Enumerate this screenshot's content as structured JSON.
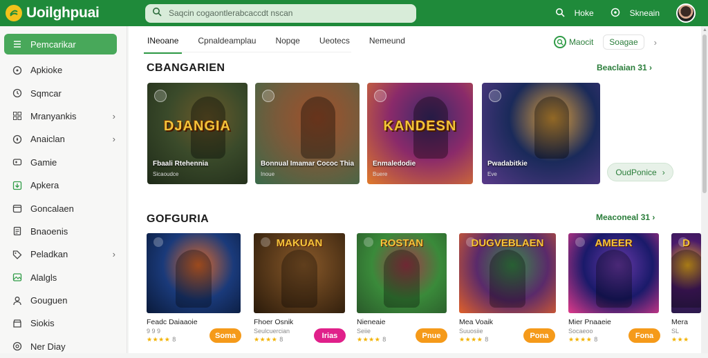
{
  "app": {
    "title": "Uoilghpuai",
    "search_placeholder": "Saqcin cogaontlerabcaccdt nscan",
    "top_actions": [
      {
        "label": "Hoke",
        "icon": "search-icon"
      },
      {
        "label": "Skneain",
        "icon": "compass-icon"
      }
    ]
  },
  "sidebar": {
    "items": [
      {
        "label": "Pemcarikar",
        "icon": "list-icon",
        "active": true,
        "chevron": false
      },
      {
        "label": "Apkioke",
        "icon": "target-icon",
        "active": false,
        "chevron": false
      },
      {
        "label": "Sqmcar",
        "icon": "clock-icon",
        "active": false,
        "chevron": false
      },
      {
        "label": "Mranyankis",
        "icon": "grid-icon",
        "active": false,
        "chevron": true
      },
      {
        "label": "Anaiclan",
        "icon": "compass-icon",
        "active": false,
        "chevron": true
      },
      {
        "label": "Gamie",
        "icon": "gamepad-icon",
        "active": false,
        "chevron": false
      },
      {
        "label": "Apkera",
        "icon": "download-icon",
        "active": false,
        "chevron": false
      },
      {
        "label": "Goncalaen",
        "icon": "calendar-icon",
        "active": false,
        "chevron": false
      },
      {
        "label": "Bnaoenis",
        "icon": "document-icon",
        "active": false,
        "chevron": false
      },
      {
        "label": "Peladkan",
        "icon": "tag-icon",
        "active": false,
        "chevron": true
      },
      {
        "label": "Alalgls",
        "icon": "image-icon",
        "active": false,
        "chevron": false
      },
      {
        "label": "Gouguen",
        "icon": "user-icon",
        "active": false,
        "chevron": false
      },
      {
        "label": "Siokis",
        "icon": "shop-icon",
        "active": false,
        "chevron": false
      },
      {
        "label": "Ner Diay",
        "icon": "settings-icon",
        "active": false,
        "chevron": false
      }
    ]
  },
  "tabs": [
    {
      "label": "INeoane",
      "active": true
    },
    {
      "label": "Cpnaldeamplau",
      "active": false
    },
    {
      "label": "Nopqe",
      "active": false
    },
    {
      "label": "Ueotecs",
      "active": false
    },
    {
      "label": "Nemeund",
      "active": false
    }
  ],
  "tab_right": {
    "primary_label": "Maocit",
    "secondary_label": "Soagae"
  },
  "featured": {
    "title": "CBANGARIEN",
    "link": "Beaclaian 31",
    "overview_button": "OudPonice",
    "cards": [
      {
        "art_title": "DJANGIA",
        "caption": "Fbaali Rtehennia",
        "sub": "Sicaoudce",
        "colors": [
          "#3a4a2a",
          "#1e2a18",
          "#6b5a2a"
        ]
      },
      {
        "art_title": "",
        "caption": "Bonnual Imamar Cococ Thia",
        "sub": "Inoue",
        "colors": [
          "#7a5a3a",
          "#3a6a4a",
          "#a0502a"
        ]
      },
      {
        "art_title": "KANDESN",
        "caption": "Enmaledodie",
        "sub": "Buere",
        "colors": [
          "#8a2a6a",
          "#e07a2a",
          "#3a2a6a"
        ]
      },
      {
        "art_title": "",
        "caption": "Pwadabitkie",
        "sub": "Eve",
        "colors": [
          "#1a2a5a",
          "#5a3a8a",
          "#e0a03a"
        ]
      }
    ]
  },
  "games": {
    "title": "GOFGURIA",
    "link": "Meaconeal 31",
    "cards": [
      {
        "art_title": "",
        "name": "Feadc Daiaaoie",
        "sub": "9 9 9",
        "stars": "★★★★",
        "rating": "8",
        "button": "Soma",
        "button_color": "#f59a1a",
        "colors": [
          "#1a3a7a",
          "#e06a2a",
          "#0a1a3a"
        ]
      },
      {
        "art_title": "MAKUAN",
        "name": "Fhoer Osnik",
        "sub": "Seulcuercian",
        "stars": "★★★★",
        "rating": "8",
        "button": "Irias",
        "button_color": "#e0208a",
        "colors": [
          "#5a3a1a",
          "#8a5a2a",
          "#2a1a0a"
        ]
      },
      {
        "art_title": "ROSTAN",
        "name": "Nieneaie",
        "sub": "Seiie",
        "stars": "★★★★",
        "rating": "8",
        "button": "Pnue",
        "button_color": "#f59a1a",
        "colors": [
          "#3a8a3a",
          "#a03a4a",
          "#2a5a2a"
        ]
      },
      {
        "art_title": "DUGVEBLAEN",
        "name": "Mea Voaik",
        "sub": "Suuosiie",
        "stars": "★★★★",
        "rating": "8",
        "button": "Pona",
        "button_color": "#f59a1a",
        "colors": [
          "#5a2a6a",
          "#3a8a4a",
          "#e0602a"
        ]
      },
      {
        "art_title": "AMEER",
        "name": "Mier Pnaaeie",
        "sub": "Socaeoo",
        "stars": "★★★★",
        "rating": "8",
        "button": "Fona",
        "button_color": "#f59a1a",
        "colors": [
          "#1a1a6a",
          "#6a3aaa",
          "#e03a8a"
        ]
      },
      {
        "art_title": "D",
        "name": "Mera",
        "sub": "SL",
        "stars": "★★★",
        "rating": "",
        "button": "",
        "button_color": "#f59a1a",
        "colors": [
          "#4a1a6a",
          "#f0b020",
          "#2a1a4a"
        ]
      }
    ]
  }
}
